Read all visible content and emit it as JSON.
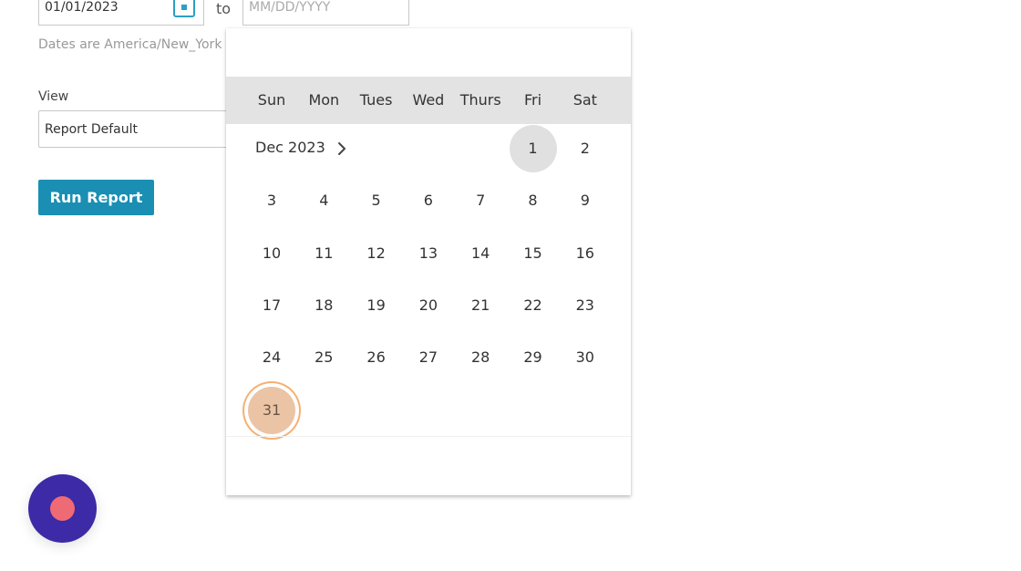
{
  "filters": {
    "start_date": "01/01/2023",
    "to_label": "to",
    "end_date_placeholder": "MM/DD/YYYY",
    "timezone_note": "Dates are America/New_York",
    "view_label": "View",
    "view_value": "Report Default",
    "run_label": "Run Report"
  },
  "calendar": {
    "weekdays": [
      "Sun",
      "Mon",
      "Tues",
      "Wed",
      "Thurs",
      "Fri",
      "Sat"
    ],
    "month_label": "Dec 2023",
    "days": [
      "1",
      "2",
      "3",
      "4",
      "5",
      "6",
      "7",
      "8",
      "9",
      "10",
      "11",
      "12",
      "13",
      "14",
      "15",
      "16",
      "17",
      "18",
      "19",
      "20",
      "21",
      "22",
      "23",
      "24",
      "25",
      "26",
      "27",
      "28",
      "29",
      "30",
      "31"
    ],
    "first_weekday_index": 5,
    "highlighted_day": "1",
    "selected_day": "31"
  },
  "colors": {
    "accent": "#1a8fb3",
    "selected_fill": "#ebc4a6",
    "selected_ring": "#f5b072",
    "header_bg": "#e3e3e3",
    "record_button": "#3c2aa6",
    "record_dot": "#ee6a75"
  },
  "icons": {
    "calendar": "calendar-icon",
    "next_month": "chevron-right-icon",
    "record": "record-icon"
  }
}
